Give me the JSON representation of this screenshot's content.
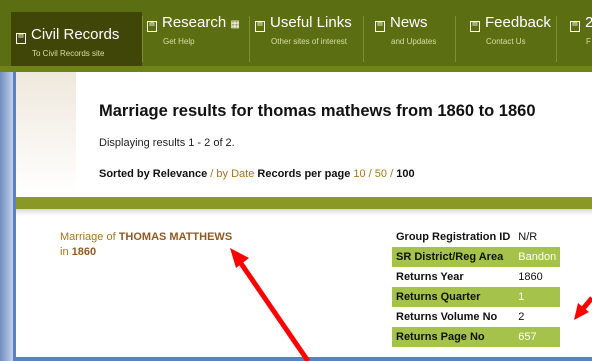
{
  "nav": {
    "items": [
      {
        "label": "Civil Records",
        "sub": "To Civil Records site"
      },
      {
        "label": "Research",
        "sub": "Get Help"
      },
      {
        "label": "Useful Links",
        "sub": "Other sites of interest"
      },
      {
        "label": "News",
        "sub": "and Updates"
      },
      {
        "label": "Feedback",
        "sub": "Contact Us"
      },
      {
        "label": "2",
        "sub": "F"
      }
    ]
  },
  "results": {
    "title": "Marriage results for thomas mathews from 1860 to 1860",
    "displaying": "Displaying results 1 - 2 of 2.",
    "sorted_by": "Sorted by",
    "relevance": "Relevance",
    "slash1": " / ",
    "by_date": "by Date",
    "per_page_label": "Records per page",
    "pp10": "10",
    "slash2": " / ",
    "pp50": "50",
    "slash3": " / ",
    "pp100": "100"
  },
  "record": {
    "prefix": "Marriage of ",
    "name": "THOMAS MATTHEWS",
    "in_label": "in ",
    "year": "1860",
    "details": [
      {
        "key": "Group Registration ID",
        "value": "N/R"
      },
      {
        "key": "SR District/Reg Area",
        "value": "Bandon"
      },
      {
        "key": "Returns Year",
        "value": "1860"
      },
      {
        "key": "Returns Quarter",
        "value": "1"
      },
      {
        "key": "Returns Volume No",
        "value": "2"
      },
      {
        "key": "Returns Page No",
        "value": "657"
      }
    ]
  },
  "colors": {
    "nav": "#5c6e12",
    "highlight": "#a5c24a",
    "link": "#a5761e",
    "arrow": "#ff0000"
  },
  "icons": {
    "nav_icon": "document-icon",
    "dropdown": "grid-icon"
  }
}
